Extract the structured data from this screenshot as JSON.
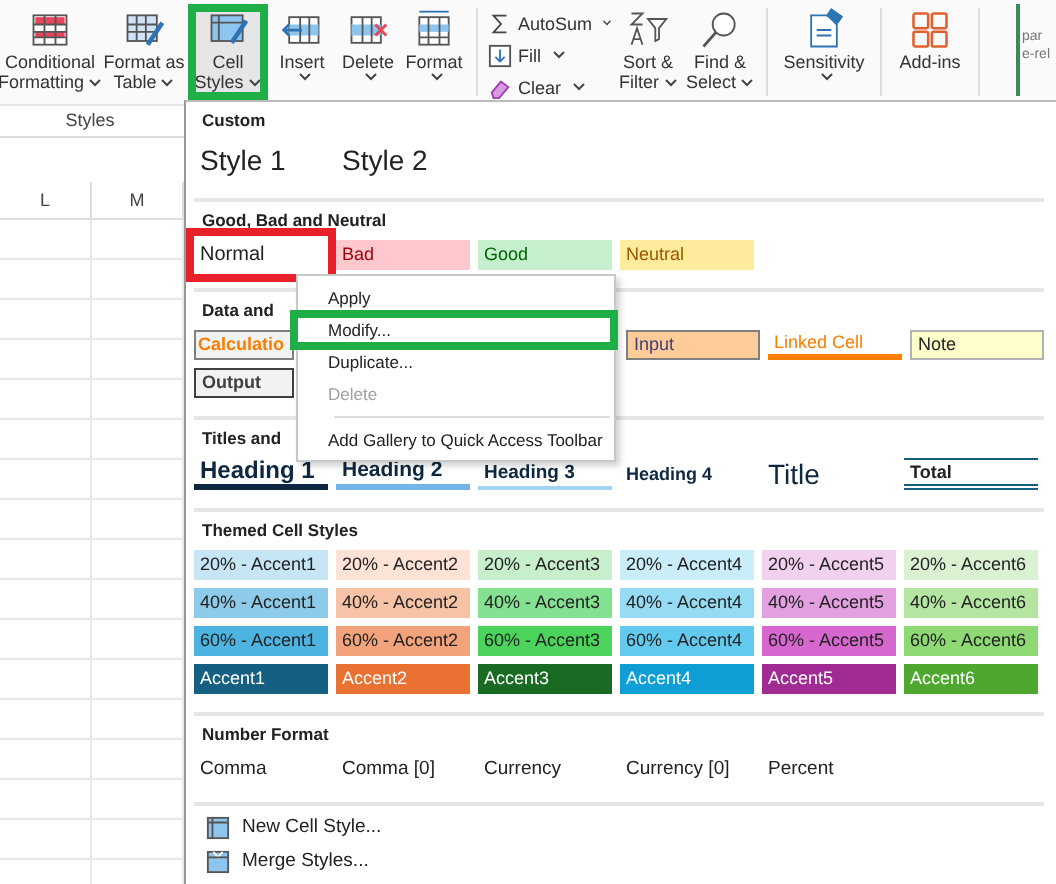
{
  "ribbon": {
    "buttons": [
      {
        "lines": [
          "Conditional",
          "Formatting"
        ],
        "dropdown": true
      },
      {
        "lines": [
          "Format as",
          "Table"
        ],
        "dropdown": true
      },
      {
        "lines": [
          "Cell",
          "Styles"
        ],
        "dropdown": true,
        "highlighted": true
      },
      {
        "lines": [
          "Insert"
        ],
        "dropdown": true
      },
      {
        "lines": [
          "Delete"
        ],
        "dropdown": true
      },
      {
        "lines": [
          "Format"
        ],
        "dropdown": true
      }
    ],
    "editing": [
      {
        "label": "AutoSum"
      },
      {
        "label": "Fill"
      },
      {
        "label": "Clear"
      }
    ],
    "buttons2": [
      {
        "lines": [
          "Sort &",
          "Filter"
        ],
        "dropdown": true
      },
      {
        "lines": [
          "Find &",
          "Select"
        ],
        "dropdown": true
      }
    ],
    "buttons3": [
      {
        "lines": [
          "Sensitivity"
        ],
        "dropdown": true
      }
    ],
    "buttons4": [
      {
        "lines": [
          "Add-ins"
        ],
        "dropdown": false
      }
    ],
    "group_label": "Styles",
    "side_panel": [
      "par",
      "e-rel"
    ]
  },
  "sheet": {
    "columns": [
      "L",
      "M"
    ]
  },
  "gallery": {
    "sections": [
      {
        "title": "Custom",
        "rows": [
          [
            {
              "kind": "large",
              "text": "Style 1"
            },
            {
              "kind": "large",
              "text": "Style 2"
            }
          ]
        ]
      },
      {
        "title": "Good, Bad and Neutral",
        "rows": [
          [
            {
              "kind": "normal",
              "text": "Normal",
              "highlighted": true
            },
            {
              "kind": "bad",
              "text": "Bad"
            },
            {
              "kind": "good",
              "text": "Good"
            },
            {
              "kind": "neutral",
              "text": "Neutral"
            }
          ]
        ]
      },
      {
        "title": "Data and",
        "rows": [
          [
            {
              "kind": "calculation",
              "text": "Calculatio"
            },
            {
              "kind": "input",
              "text": "Input"
            },
            {
              "kind": "linked",
              "text": "Linked Cell"
            },
            {
              "kind": "note",
              "text": "Note"
            }
          ],
          [
            {
              "kind": "output",
              "text": "Output"
            }
          ]
        ]
      },
      {
        "title": "Titles and",
        "rows": [
          [
            {
              "kind": "heading1",
              "text": "Heading 1"
            },
            {
              "kind": "heading2",
              "text": "Heading 2"
            },
            {
              "kind": "heading3",
              "text": "Heading 3"
            },
            {
              "kind": "heading4",
              "text": "Heading 4"
            },
            {
              "kind": "title",
              "text": "Title"
            },
            {
              "kind": "total",
              "text": "Total"
            }
          ]
        ]
      },
      {
        "title": "Themed Cell Styles",
        "rows": [
          [
            {
              "kind": "fill",
              "text": "20% - Accent1",
              "color": "#c6e6f6"
            },
            {
              "kind": "fill",
              "text": "20% - Accent2",
              "color": "#fde3d6"
            },
            {
              "kind": "fill",
              "text": "20% - Accent3",
              "color": "#c8efcc"
            },
            {
              "kind": "fill",
              "text": "20% - Accent4",
              "color": "#caedfa"
            },
            {
              "kind": "fill",
              "text": "20% - Accent5",
              "color": "#f2d1ef"
            },
            {
              "kind": "fill",
              "text": "20% - Accent6",
              "color": "#daf2d1"
            }
          ],
          [
            {
              "kind": "fill",
              "text": "40% - Accent1",
              "color": "#8ecbea"
            },
            {
              "kind": "fill",
              "text": "40% - Accent2",
              "color": "#f7c3a6"
            },
            {
              "kind": "fill",
              "text": "40% - Accent3",
              "color": "#85e192"
            },
            {
              "kind": "fill",
              "text": "40% - Accent4",
              "color": "#95dbf4"
            },
            {
              "kind": "fill",
              "text": "40% - Accent5",
              "color": "#e2a0e0"
            },
            {
              "kind": "fill",
              "text": "40% - Accent6",
              "color": "#b4e6a2"
            }
          ],
          [
            {
              "kind": "fill",
              "text": "60% - Accent1",
              "color": "#4db3e0"
            },
            {
              "kind": "fill",
              "text": "60% - Accent2",
              "color": "#f2a37b"
            },
            {
              "kind": "fill",
              "text": "60% - Accent3",
              "color": "#4bd35b"
            },
            {
              "kind": "fill",
              "text": "60% - Accent4",
              "color": "#62caef"
            },
            {
              "kind": "fill",
              "text": "60% - Accent5",
              "color": "#d567cf"
            },
            {
              "kind": "fill",
              "text": "60% - Accent6",
              "color": "#8fd974"
            }
          ],
          [
            {
              "kind": "dark",
              "text": "Accent1",
              "color": "#156082"
            },
            {
              "kind": "dark",
              "text": "Accent2",
              "color": "#e97132"
            },
            {
              "kind": "dark",
              "text": "Accent3",
              "color": "#196b24"
            },
            {
              "kind": "dark",
              "text": "Accent4",
              "color": "#0f9ed5"
            },
            {
              "kind": "dark",
              "text": "Accent5",
              "color": "#a02b93"
            },
            {
              "kind": "dark",
              "text": "Accent6",
              "color": "#4ea72e"
            }
          ]
        ]
      },
      {
        "title": "Number Format",
        "rows": [
          [
            {
              "kind": "plain",
              "text": "Comma"
            },
            {
              "kind": "plain",
              "text": "Comma [0]"
            },
            {
              "kind": "plain",
              "text": "Currency"
            },
            {
              "kind": "plain",
              "text": "Currency [0]"
            },
            {
              "kind": "plain",
              "text": "Percent"
            }
          ]
        ]
      }
    ],
    "commands": [
      {
        "label": "New Cell Style..."
      },
      {
        "label": "Merge Styles..."
      }
    ]
  },
  "context_menu": {
    "items": [
      {
        "kind": "item",
        "label": "Apply",
        "disabled": false
      },
      {
        "kind": "item",
        "label": "Modify...",
        "disabled": false,
        "highlighted": true
      },
      {
        "kind": "item",
        "label": "Duplicate...",
        "disabled": false
      },
      {
        "kind": "item",
        "label": "Delete",
        "disabled": true
      },
      {
        "kind": "separator"
      },
      {
        "kind": "item",
        "label": "Add Gallery to Quick Access Toolbar",
        "disabled": false
      }
    ]
  }
}
